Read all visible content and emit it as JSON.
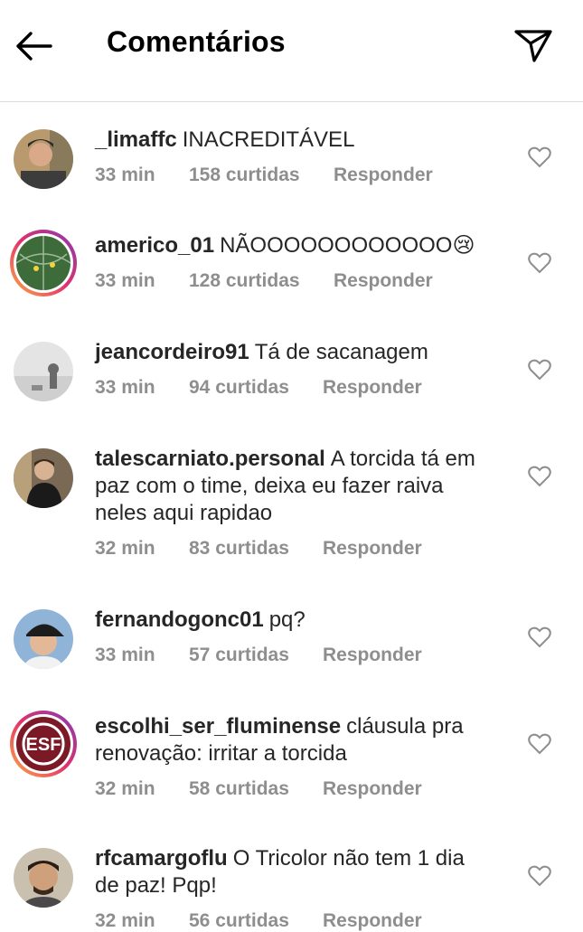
{
  "header": {
    "title": "Comentários",
    "back_icon": "arrow-left-icon",
    "share_icon": "paper-plane-icon"
  },
  "comments": [
    {
      "username": "_limaffc",
      "text": "INACREDITÁVEL",
      "time": "33 min",
      "likes": "158 curtidas",
      "reply": "Responder"
    },
    {
      "username": "americo_01",
      "text": "NÃOOOOOOOOOOOO😢",
      "time": "33 min",
      "likes": "128 curtidas",
      "reply": "Responder"
    },
    {
      "username": "jeancordeiro91",
      "text": "Tá de sacanagem",
      "time": "33 min",
      "likes": "94 curtidas",
      "reply": "Responder"
    },
    {
      "username": "talescarniato.personal",
      "text": "A torcida tá em paz com o time, deixa eu fazer raiva neles aqui rapidao",
      "time": "32 min",
      "likes": "83 curtidas",
      "reply": "Responder"
    },
    {
      "username": "fernandogonc01",
      "text": "pq?",
      "time": "33 min",
      "likes": "57 curtidas",
      "reply": "Responder"
    },
    {
      "username": "escolhi_ser_fluminense",
      "text": "cláusula pra renovação: irritar a torcida",
      "time": "32 min",
      "likes": "58 curtidas",
      "reply": "Responder"
    },
    {
      "username": "rfcamargoflu",
      "text": "O Tricolor não tem 1 dia de paz! Pqp!",
      "time": "32 min",
      "likes": "56 curtidas",
      "reply": "Responder"
    }
  ],
  "avatar_logo_text": "ESF"
}
